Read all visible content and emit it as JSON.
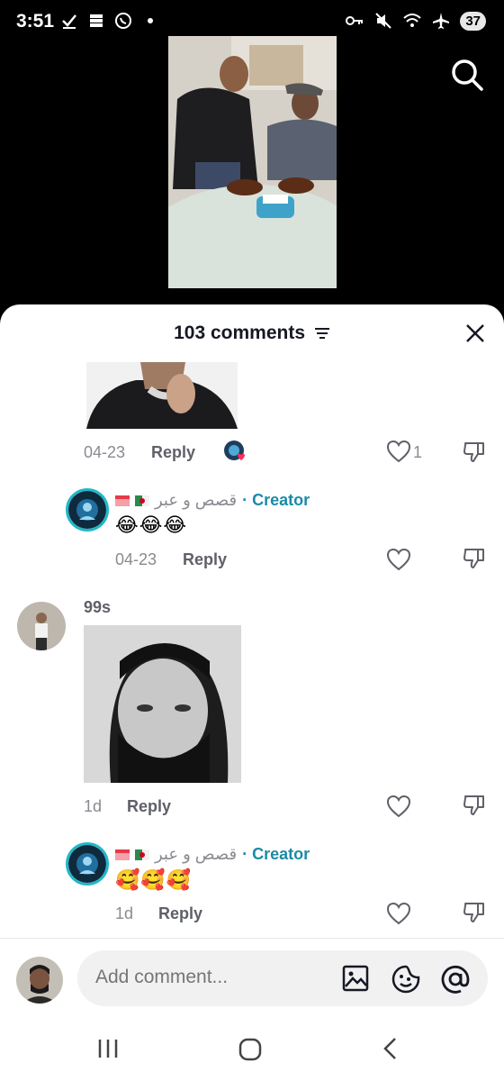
{
  "status": {
    "time": "3:51",
    "battery": "37"
  },
  "sheet": {
    "title": "103 comments"
  },
  "comments": [
    {
      "date": "04-23",
      "reply_label": "Reply",
      "like_count": "1"
    },
    {
      "username": "قصص و عبر",
      "creator_label": "· Creator",
      "emojis": "😂😂😂",
      "date": "04-23",
      "reply_label": "Reply"
    },
    {
      "author": "99s",
      "date": "1d",
      "reply_label": "Reply"
    },
    {
      "username": "قصص و عبر",
      "creator_label": "· Creator",
      "emojis": "🥰🥰🥰",
      "date": "1d",
      "reply_label": "Reply"
    }
  ],
  "input": {
    "placeholder": "Add comment..."
  },
  "colors": {
    "creator": "#1c8aa6",
    "muted": "#8a8b91",
    "sheet_bg": "#ffffff"
  }
}
